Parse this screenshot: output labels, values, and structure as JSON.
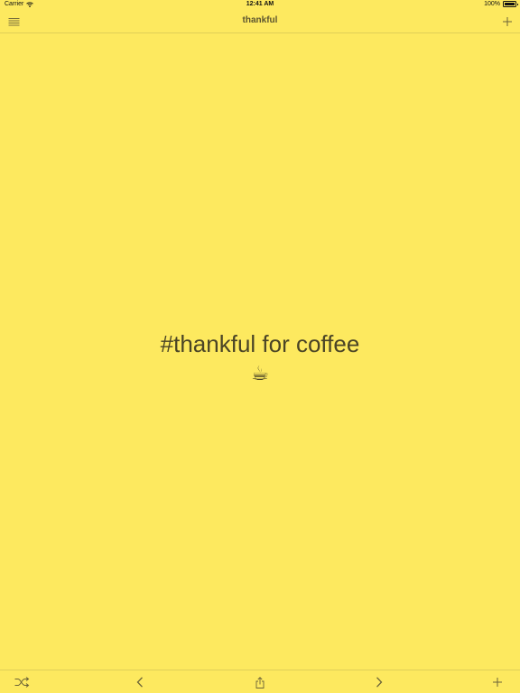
{
  "status_bar": {
    "carrier": "Carrier",
    "time": "12:41 AM",
    "battery": "100%",
    "battery_level": 1.0
  },
  "nav": {
    "title": "thankful",
    "left_icon": "menu-icon",
    "right_icon": "plus-icon"
  },
  "entry": {
    "text": "#thankful for coffee",
    "emoji": "☕"
  },
  "toolbar": {
    "icons": [
      "shuffle-icon",
      "chevron-left-icon",
      "share-icon",
      "chevron-right-icon",
      "plus-icon"
    ]
  },
  "colors": {
    "background": "#fde95f",
    "icon": "#6b6338",
    "text": "#4a4426"
  }
}
